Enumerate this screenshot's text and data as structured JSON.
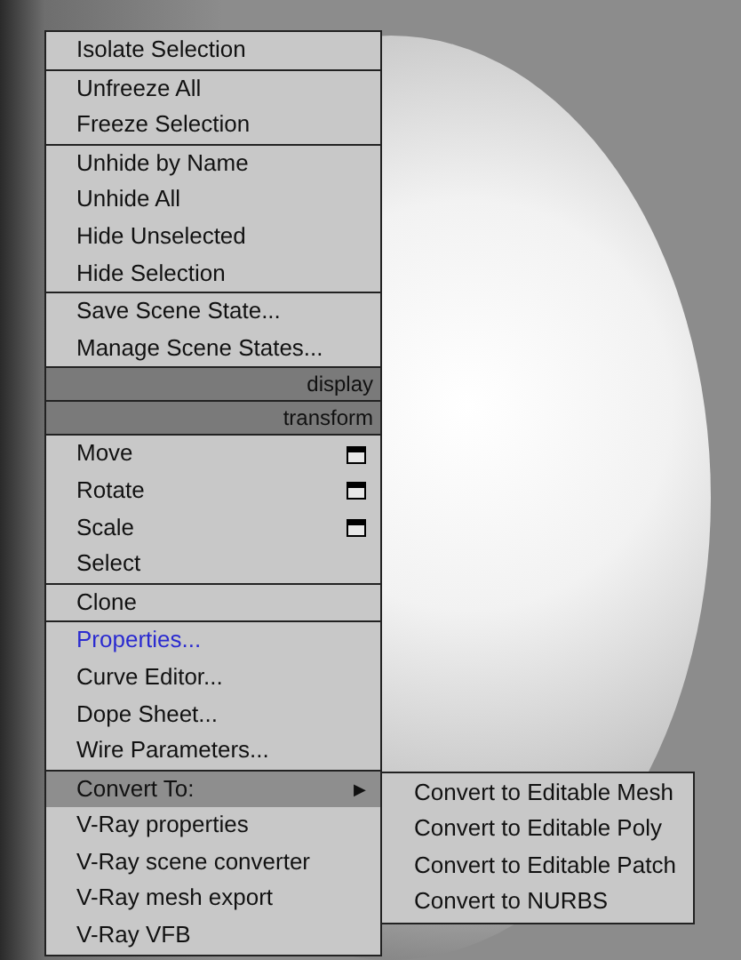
{
  "menu": {
    "groups": [
      {
        "kind": "section",
        "items": [
          {
            "label": "Isolate Selection",
            "kind": "plain",
            "selected": false
          }
        ]
      },
      {
        "kind": "section",
        "items": [
          {
            "label": "Unfreeze All",
            "kind": "plain",
            "selected": false
          },
          {
            "label": "Freeze Selection",
            "kind": "plain",
            "selected": false
          }
        ]
      },
      {
        "kind": "section",
        "items": [
          {
            "label": "Unhide by Name",
            "kind": "plain",
            "selected": false
          },
          {
            "label": "Unhide All",
            "kind": "plain",
            "selected": false
          },
          {
            "label": "Hide Unselected",
            "kind": "plain",
            "selected": false
          },
          {
            "label": "Hide Selection",
            "kind": "plain",
            "selected": false
          }
        ]
      },
      {
        "kind": "section",
        "items": [
          {
            "label": "Save Scene State...",
            "kind": "plain",
            "selected": false
          },
          {
            "label": "Manage Scene States...",
            "kind": "plain",
            "selected": false
          }
        ]
      },
      {
        "kind": "header",
        "label": "display"
      },
      {
        "kind": "header",
        "label": "transform"
      },
      {
        "kind": "section",
        "items": [
          {
            "label": "Move",
            "kind": "options",
            "selected": false
          },
          {
            "label": "Rotate",
            "kind": "options",
            "selected": false
          },
          {
            "label": "Scale",
            "kind": "options",
            "selected": false
          },
          {
            "label": "Select",
            "kind": "plain",
            "selected": false
          }
        ]
      },
      {
        "kind": "section",
        "items": [
          {
            "label": "Clone",
            "kind": "plain",
            "selected": false
          }
        ]
      },
      {
        "kind": "section",
        "items": [
          {
            "label": "Properties...",
            "kind": "link",
            "selected": false
          },
          {
            "label": "Curve Editor...",
            "kind": "plain",
            "selected": false
          },
          {
            "label": "Dope Sheet...",
            "kind": "plain",
            "selected": false
          },
          {
            "label": "Wire Parameters...",
            "kind": "plain",
            "selected": false
          }
        ]
      },
      {
        "kind": "section",
        "items": [
          {
            "label": "Convert To:",
            "kind": "submenu",
            "selected": true,
            "arrow": "▶",
            "children": [
              "Convert to Editable Mesh",
              "Convert to Editable Poly",
              "Convert to Editable Patch",
              "Convert to NURBS"
            ]
          },
          {
            "label": "V-Ray properties",
            "kind": "plain",
            "selected": false
          },
          {
            "label": "V-Ray scene converter",
            "kind": "plain",
            "selected": false
          },
          {
            "label": "V-Ray mesh export",
            "kind": "plain",
            "selected": false
          },
          {
            "label": "V-Ray VFB",
            "kind": "plain",
            "selected": false
          }
        ]
      }
    ]
  }
}
